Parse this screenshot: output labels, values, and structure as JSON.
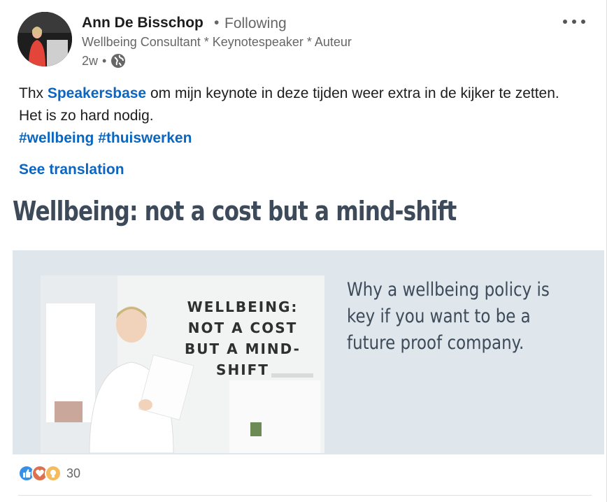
{
  "post": {
    "author": {
      "name": "Ann De Bisschop",
      "separator": "•",
      "follow_status": "Following",
      "headline": "Wellbeing Consultant * Keynotespeaker * Auteur",
      "time": "2w",
      "meta_separator": "•"
    },
    "text": {
      "prefix": "Thx ",
      "mention": "Speakersbase",
      "body": " om mijn keynote in deze tijden weer extra in de kijker te zetten. Het is zo hard nodig.",
      "hashtags": [
        "#wellbeing",
        "#thuiswerken"
      ]
    },
    "see_translation": "See translation",
    "article": {
      "title": "Wellbeing: not a cost but a mind-shift",
      "image_text": [
        "WELLBEING:",
        "NOT A COST",
        "BUT A MIND-SHIFT"
      ],
      "banner_text": "Why a wellbeing policy is key if you want to be a future proof company."
    },
    "reactions": {
      "icons": [
        "like-icon",
        "love-icon",
        "insightful-icon"
      ],
      "count": "30"
    }
  },
  "colors": {
    "link": "#0a66c2",
    "muted": "#666666",
    "banner_bg": "#dfe6ec",
    "title_text": "#3d4a59"
  }
}
